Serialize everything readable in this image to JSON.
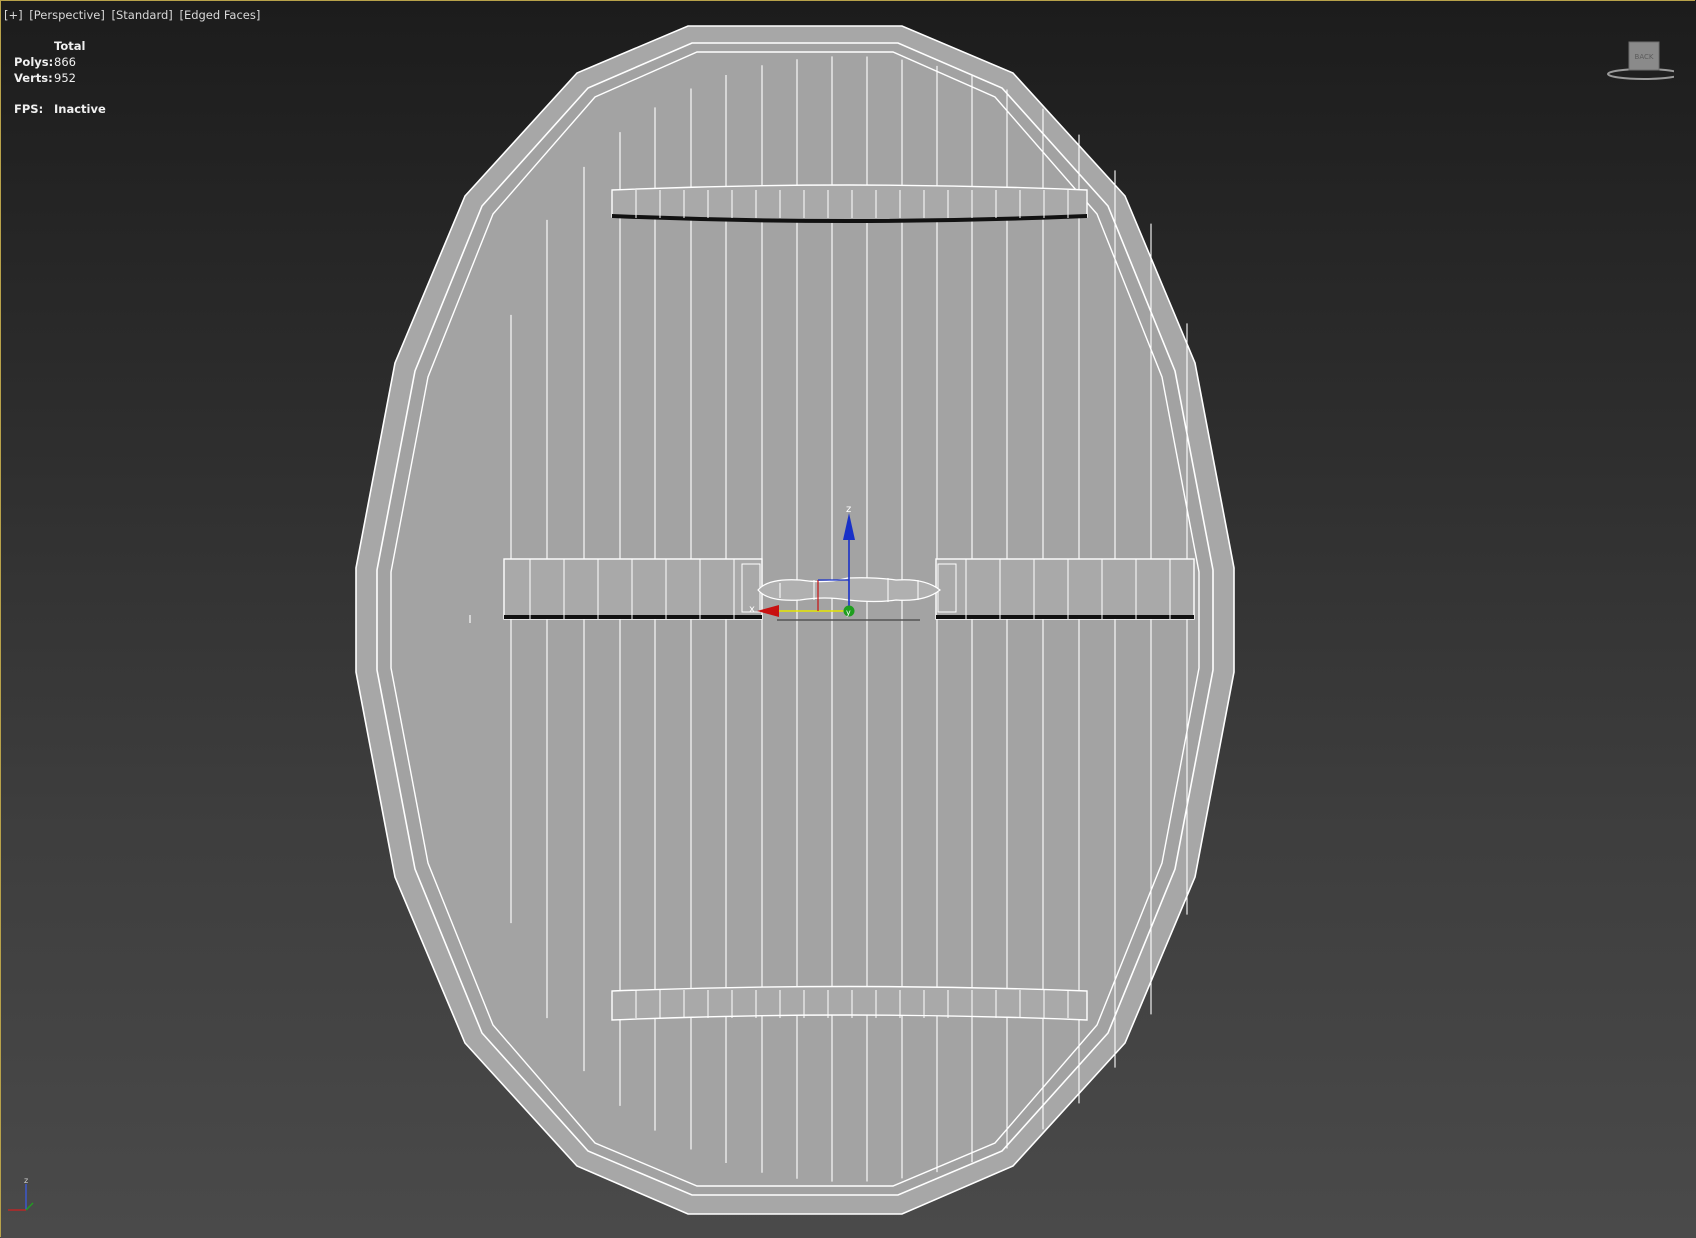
{
  "viewport": {
    "menu": [
      "[+]",
      "[Perspective]",
      "[Standard]",
      "[Edged Faces]"
    ],
    "frame_color": "#b8a24a"
  },
  "stats": {
    "header": "Total",
    "polys_label": "Polys:",
    "polys_value": "866",
    "verts_label": "Verts:",
    "verts_value": "952",
    "fps_label": "FPS:",
    "fps_value": "Inactive"
  },
  "gizmo": {
    "z_label": "z",
    "x_label": "x",
    "y_label": "y"
  },
  "viewcube": {
    "face_label": "BACK"
  },
  "tripod": {
    "z_label": "z"
  },
  "colors": {
    "mesh_fill": "#a3a3a3",
    "wire": "#ffffff",
    "axis_x": "#c81010",
    "axis_y": "#1e9e1e",
    "axis_z": "#1830c8",
    "gizmo_plane": "#e6e600"
  }
}
